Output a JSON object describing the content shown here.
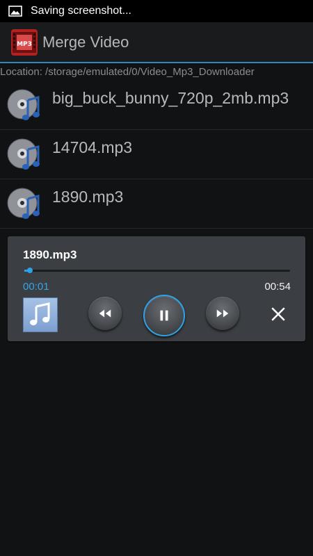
{
  "status_bar": {
    "text": "Saving screenshot..."
  },
  "action_bar": {
    "title": "Merge Video",
    "logo_text": "MP3"
  },
  "location": "Location: /storage/emulated/0/Video_Mp3_Downloader",
  "files": [
    {
      "name": "big_buck_bunny_720p_2mb.mp3"
    },
    {
      "name": "14704.mp3"
    },
    {
      "name": "1890.mp3"
    }
  ],
  "player": {
    "title": "1890.mp3",
    "elapsed": "00:01",
    "total": "00:54",
    "progress_fraction": 0.02,
    "accent_color": "#2ea2e6",
    "controls": [
      "rewind-icon",
      "pause-icon",
      "fast-forward-icon",
      "close-icon"
    ]
  }
}
